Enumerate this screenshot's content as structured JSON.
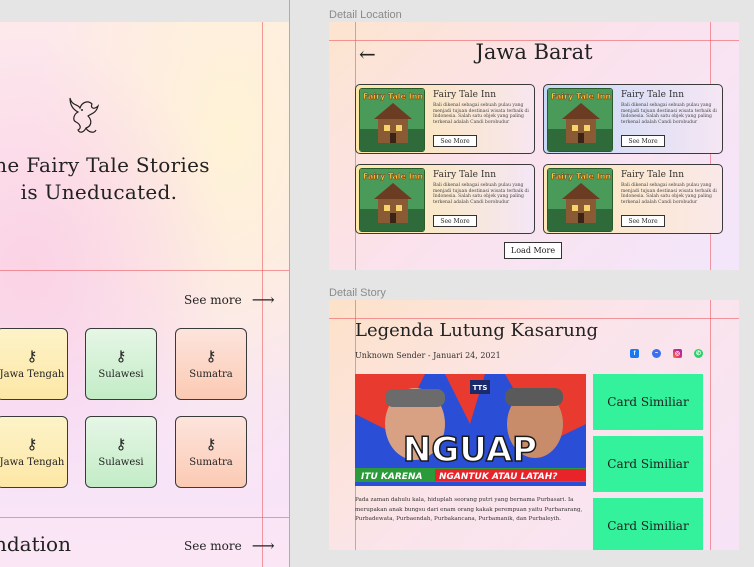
{
  "left": {
    "hero_line1": "me Fairy Tale Stories",
    "hero_line2": "is Uneducated.",
    "see_more_1": "See more",
    "see_more_2": "See more",
    "arrow": "⟶",
    "tiles_row1": [
      {
        "label": "Jawa Tengah",
        "color": "yellow"
      },
      {
        "label": "Sulawesi",
        "color": "green"
      },
      {
        "label": "Sumatra",
        "color": "peach"
      }
    ],
    "tiles_row2": [
      {
        "label": "Jawa Tengah",
        "color": "yellow"
      },
      {
        "label": "Sulawesi",
        "color": "green"
      },
      {
        "label": "Sumatra",
        "color": "peach"
      }
    ],
    "section_title": "ndation",
    "icons": {
      "tile": "key-icon",
      "hero": "dragon-icon"
    }
  },
  "detail_location": {
    "frame_label": "Detail Location",
    "title": "Jawa Barat",
    "back_icon": "back-arrow-icon",
    "cards": [
      {
        "title": "Fairy Tale Inn",
        "desc": "Bali dikenal sebagai sebuah pulau yang menjadi tujuan destinasi wisata terbaik di Indonesia. Salah satu objek yang paling terkenal adalah Candi borobudur",
        "button": "See More"
      },
      {
        "title": "Fairy Tale Inn",
        "desc": "Bali dikenal sebagai sebuah pulau yang menjadi tujuan destinasi wisata terbaik di Indonesia. Salah satu objek yang paling terkenal adalah Candi borobudur",
        "button": "See More"
      },
      {
        "title": "Fairy Tale Inn",
        "desc": "Bali dikenal sebagai sebuah pulau yang menjadi tujuan destinasi wisata terbaik di Indonesia. Salah satu objek yang paling terkenal adalah Candi borobudur",
        "button": "See More"
      },
      {
        "title": "Fairy Tale Inn",
        "desc": "Bali dikenal sebagai sebuah pulau yang menjadi tujuan destinasi wisata terbaik di Indonesia. Salah satu objek yang paling terkenal adalah Candi borobudur",
        "button": "See More"
      }
    ],
    "thumb_text": "Fairy Tale Inn",
    "load_more": "Load More"
  },
  "detail_story": {
    "frame_label": "Detail Story",
    "title": "Legenda Lutung Kasarung",
    "sender": "Unknown Sender -",
    "date": "Januari 24, 2021",
    "social_icons": [
      "facebook-icon",
      "messenger-icon",
      "instagram-icon",
      "whatsapp-icon"
    ],
    "image_headline": "NGUAP",
    "image_sub_1": "ITU KARENA",
    "image_sub_2": "NGANTUK ATAU LATAH?",
    "image_badge": "TTS",
    "body": "Pada zaman dahulu kala, hiduplah seorang putri yang bernama Purbasari. Ia merupakan anak bungsu dari enam orang kakak perempuan yaitu Purbararang, Purbadewata, Purbaendah, Purbakancana, Purbamanik, dan Purbaleyih.",
    "similar_cards": [
      "Card Similiar",
      "Card Similiar",
      "Card Similiar"
    ]
  },
  "colors": {
    "accent_green": "#34f29b",
    "guide_red": "#eb505a"
  }
}
